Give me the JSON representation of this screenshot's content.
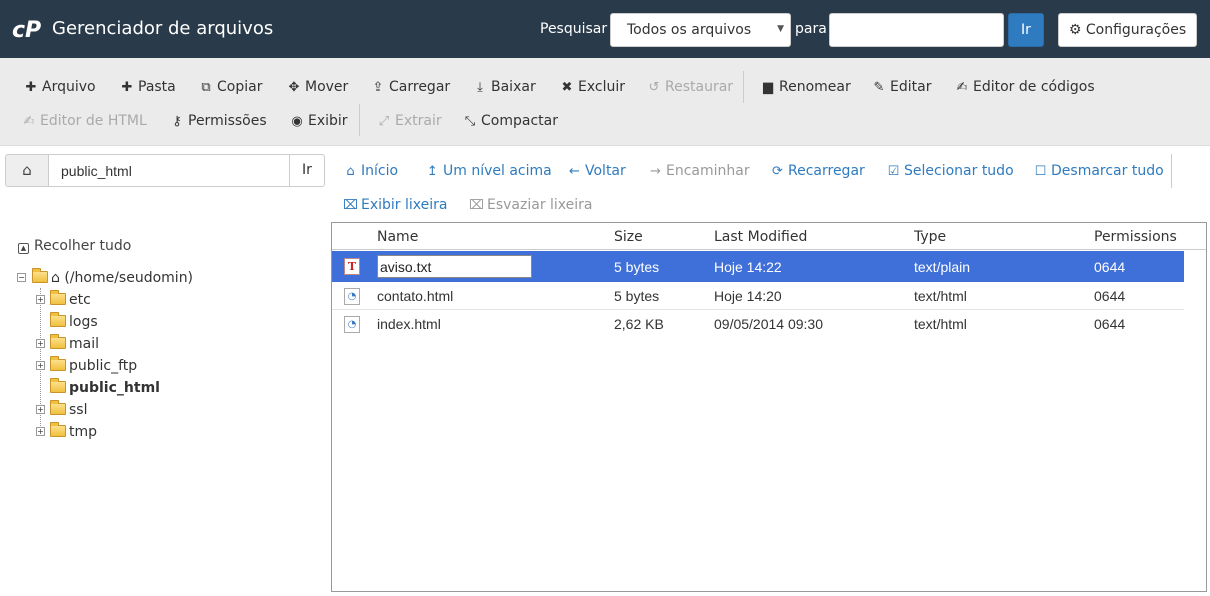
{
  "header": {
    "logo_text": "cP",
    "title": "Gerenciador de arquivos",
    "search_label": "Pesquisar",
    "search_scope": "Todos os arquivos",
    "para_label": "para",
    "search_value": "",
    "go_label": "Ir",
    "settings_label": "Configurações"
  },
  "toolbar": {
    "row1": [
      {
        "label": "Arquivo",
        "icon": "plus-icon",
        "glyph": "✚",
        "disabled": false
      },
      {
        "label": "Pasta",
        "icon": "plus-icon",
        "glyph": "✚",
        "disabled": false
      },
      {
        "label": "Copiar",
        "icon": "copy-icon",
        "glyph": "⧉",
        "disabled": false
      },
      {
        "label": "Mover",
        "icon": "move-icon",
        "glyph": "✥",
        "disabled": false
      },
      {
        "label": "Carregar",
        "icon": "upload-icon",
        "glyph": "⇪",
        "disabled": false
      },
      {
        "label": "Baixar",
        "icon": "download-icon",
        "glyph": "⤓",
        "disabled": false
      },
      {
        "label": "Excluir",
        "icon": "times-icon",
        "glyph": "✖",
        "disabled": false
      },
      {
        "label": "Restaurar",
        "icon": "undo-icon",
        "glyph": "↺",
        "disabled": true
      },
      {
        "label": "Renomear",
        "icon": "file-icon",
        "glyph": "▆",
        "disabled": false
      },
      {
        "label": "Editar",
        "icon": "pencil-icon",
        "glyph": "✎",
        "disabled": false
      },
      {
        "label": "Editor de códigos",
        "icon": "edit-icon",
        "glyph": "✍",
        "disabled": false
      }
    ],
    "row2": [
      {
        "label": "Editor de HTML",
        "icon": "edit-icon",
        "glyph": "✍",
        "disabled": true
      },
      {
        "label": "Permissões",
        "icon": "key-icon",
        "glyph": "⚷",
        "disabled": false
      },
      {
        "label": "Exibir",
        "icon": "eye-icon",
        "glyph": "◉",
        "disabled": false
      },
      {
        "label": "Extrair",
        "icon": "expand-icon",
        "glyph": "⤢",
        "disabled": true
      },
      {
        "label": "Compactar",
        "icon": "compress-icon",
        "glyph": "⤡",
        "disabled": false
      }
    ]
  },
  "pathbar": {
    "path_value": "public_html",
    "go_label": "Ir"
  },
  "nav": [
    {
      "label": "Início",
      "icon": "home-icon",
      "glyph": "⌂",
      "disabled": false
    },
    {
      "label": "Um nível acima",
      "icon": "level-up-icon",
      "glyph": "↥",
      "disabled": false
    },
    {
      "label": "Voltar",
      "icon": "arrow-left-icon",
      "glyph": "←",
      "disabled": false
    },
    {
      "label": "Encaminhar",
      "icon": "arrow-right-icon",
      "glyph": "→",
      "disabled": true
    },
    {
      "label": "Recarregar",
      "icon": "refresh-icon",
      "glyph": "⟳",
      "disabled": false
    },
    {
      "label": "Selecionar tudo",
      "icon": "check-square-icon",
      "glyph": "☑",
      "disabled": false
    },
    {
      "label": "Desmarcar tudo",
      "icon": "square-icon",
      "glyph": "☐",
      "disabled": false
    },
    {
      "label": "Exibir lixeira",
      "icon": "trash-icon",
      "glyph": "🗑",
      "disabled": false
    },
    {
      "label": "Esvaziar lixeira",
      "icon": "trash-icon",
      "glyph": "🗑",
      "disabled": true
    }
  ],
  "tree": {
    "collapse_label": "Recolher tudo",
    "root_label": "(/home/seudomin)",
    "folders": [
      {
        "name": "etc",
        "expandable": true,
        "current": false
      },
      {
        "name": "logs",
        "expandable": false,
        "current": false
      },
      {
        "name": "mail",
        "expandable": true,
        "current": false
      },
      {
        "name": "public_ftp",
        "expandable": true,
        "current": false
      },
      {
        "name": "public_html",
        "expandable": false,
        "current": true
      },
      {
        "name": "ssl",
        "expandable": true,
        "current": false
      },
      {
        "name": "tmp",
        "expandable": true,
        "current": false
      }
    ]
  },
  "files": {
    "columns": {
      "name": "Name",
      "size": "Size",
      "modified": "Last Modified",
      "type": "Type",
      "permissions": "Permissions"
    },
    "rows": [
      {
        "name": "aviso.txt",
        "size": "5 bytes",
        "modified": "Hoje 14:22",
        "type": "text/plain",
        "permissions": "0644",
        "icon": "text-file-icon",
        "selected": true,
        "renaming": true
      },
      {
        "name": "contato.html",
        "size": "5 bytes",
        "modified": "Hoje 14:20",
        "type": "text/html",
        "permissions": "0644",
        "icon": "html-file-icon",
        "selected": false,
        "renaming": false
      },
      {
        "name": "index.html",
        "size": "2,62 KB",
        "modified": "09/05/2014 09:30",
        "type": "text/html",
        "permissions": "0644",
        "icon": "html-file-icon",
        "selected": false,
        "renaming": false
      }
    ]
  }
}
